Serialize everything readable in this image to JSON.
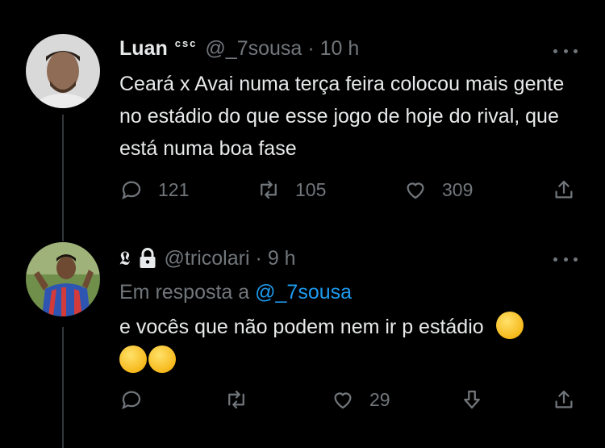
{
  "tweet1": {
    "display_name": "Luan",
    "badge": "csc",
    "handle": "@_7sousa",
    "separator": "·",
    "time": "10 h",
    "text": "Ceará x Avai numa terça feira colocou mais gente no estádio do que esse jogo de hoje do rival, que está numa boa fase",
    "reply_count": "121",
    "retweet_count": "105",
    "like_count": "309"
  },
  "tweet2": {
    "display_name_glyph": "𝕷",
    "handle": "@tricolari",
    "separator": "·",
    "time": "9 h",
    "reply_prefix": "Em resposta a",
    "reply_to_handle": "@_7sousa",
    "text": "e vocês que não podem nem ir p estádio",
    "like_count": "29"
  },
  "colors": {
    "background": "#000000",
    "text": "#e7e9ea",
    "muted": "#71767b",
    "link": "#1d9bf0"
  },
  "icons": [
    "more-icon",
    "reply-icon",
    "retweet-icon",
    "like-icon",
    "share-icon",
    "lock-icon",
    "downvote-icon",
    "rofl-emoji"
  ]
}
